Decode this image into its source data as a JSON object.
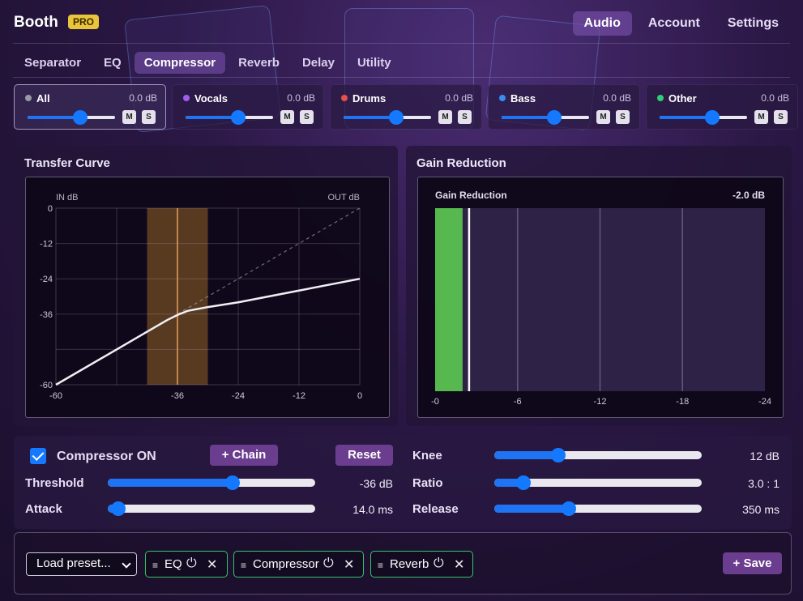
{
  "app": {
    "brand": "Booth",
    "badge": "PRO"
  },
  "topnav": {
    "items": [
      {
        "label": "Audio",
        "active": true
      },
      {
        "label": "Account",
        "active": false
      },
      {
        "label": "Settings",
        "active": false
      }
    ]
  },
  "subnav": {
    "items": [
      {
        "label": "Separator",
        "active": false
      },
      {
        "label": "EQ",
        "active": false
      },
      {
        "label": "Compressor",
        "active": true
      },
      {
        "label": "Reverb",
        "active": false
      },
      {
        "label": "Delay",
        "active": false
      },
      {
        "label": "Utility",
        "active": false
      }
    ]
  },
  "stems": [
    {
      "name": "All",
      "gain": "0.0 dB",
      "color": "#9a9aa6",
      "level": 0.6,
      "mute": "M",
      "solo": "S",
      "selected": true
    },
    {
      "name": "Vocals",
      "gain": "0.0 dB",
      "color": "#a35cf0",
      "level": 0.6,
      "mute": "M",
      "solo": "S",
      "selected": false
    },
    {
      "name": "Drums",
      "gain": "0.0 dB",
      "color": "#e8504a",
      "level": 0.6,
      "mute": "M",
      "solo": "S",
      "selected": false
    },
    {
      "name": "Bass",
      "gain": "0.0 dB",
      "color": "#3b8cf5",
      "level": 0.6,
      "mute": "M",
      "solo": "S",
      "selected": false
    },
    {
      "name": "Other",
      "gain": "0.0 dB",
      "color": "#2fcf73",
      "level": 0.6,
      "mute": "M",
      "solo": "S",
      "selected": false
    }
  ],
  "transfer": {
    "title": "Transfer Curve",
    "in_label": "IN dB",
    "out_label": "OUT dB",
    "y_ticks": [
      "0",
      "-12",
      "-24",
      "-36",
      "-60"
    ],
    "x_ticks": [
      "-60",
      "-36",
      "-24",
      "-12",
      "0"
    ]
  },
  "gain_reduction": {
    "title": "Gain Reduction",
    "meter_label": "Gain Reduction",
    "value": "-2.0 dB",
    "x_ticks": [
      "-0",
      "-6",
      "-12",
      "-18",
      "-24"
    ]
  },
  "controls": {
    "compressor_on_label": "Compressor ON",
    "compressor_on": true,
    "chain_button": "+ Chain",
    "reset_button": "Reset",
    "threshold": {
      "label": "Threshold",
      "value": "-36 dB",
      "level": 0.6
    },
    "attack": {
      "label": "Attack",
      "value": "14.0 ms",
      "level": 0.05
    },
    "knee": {
      "label": "Knee",
      "value": "12 dB",
      "level": 0.31
    },
    "ratio": {
      "label": "Ratio",
      "value": "3.0 : 1",
      "level": 0.14
    },
    "release": {
      "label": "Release",
      "value": "350 ms",
      "level": 0.36
    }
  },
  "chain": {
    "preset_placeholder": "Load preset...",
    "items": [
      {
        "label": "EQ"
      },
      {
        "label": "Compressor"
      },
      {
        "label": "Reverb"
      }
    ],
    "save_button": "+ Save"
  },
  "chart_data": [
    {
      "type": "line",
      "title": "Transfer Curve",
      "xlabel": "IN dB",
      "ylabel": "OUT dB",
      "xlim": [
        -60,
        0
      ],
      "ylim": [
        -60,
        0
      ],
      "x_ticks": [
        -60,
        -36,
        -24,
        -12,
        0
      ],
      "y_ticks": [
        0,
        -12,
        -24,
        -36,
        -60
      ],
      "threshold": -36,
      "knee": 12,
      "ratio": 3,
      "series": [
        {
          "x": [
            -60,
            -48,
            -42,
            -38,
            -36,
            -34,
            -30,
            -24,
            -12,
            0
          ],
          "y": [
            -60,
            -48,
            -42,
            -38,
            -36.3,
            -34.9,
            -33.6,
            -32,
            -28,
            -24
          ]
        },
        {
          "x": [
            -36,
            0
          ],
          "y": [
            -36,
            0
          ],
          "style": "dashed"
        }
      ]
    },
    {
      "type": "bar",
      "title": "Gain Reduction",
      "xlim": [
        0,
        -24
      ],
      "x_ticks": [
        0,
        -6,
        -12,
        -18,
        -24
      ],
      "values": [
        -2.0
      ]
    }
  ]
}
